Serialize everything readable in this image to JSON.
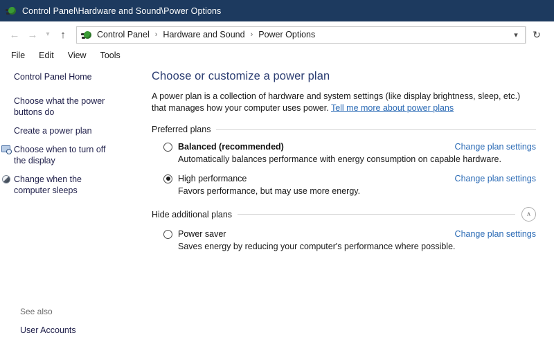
{
  "window": {
    "title": "Control Panel\\Hardware and Sound\\Power Options",
    "title_icon": "power-plug-icon"
  },
  "navbar": {
    "back_icon": "arrow-left-icon",
    "forward_icon": "arrow-right-icon",
    "recent_icon": "chevron-down-icon",
    "up_icon": "arrow-up-icon",
    "address_icon": "power-plug-icon",
    "breadcrumbs": [
      "Control Panel",
      "Hardware and Sound",
      "Power Options"
    ],
    "separator": "›",
    "dropdown_icon": "chevron-down-icon",
    "refresh_icon": "refresh-icon",
    "refresh_glyph": "↻"
  },
  "menubar": {
    "items": [
      "File",
      "Edit",
      "View",
      "Tools"
    ]
  },
  "sidebar": {
    "home": "Control Panel Home",
    "items": [
      {
        "label": "Choose what the power buttons do",
        "icon": ""
      },
      {
        "label": "Create a power plan",
        "icon": ""
      },
      {
        "label": "Choose when to turn off the display",
        "icon": "display-clock-icon"
      },
      {
        "label": "Change when the computer sleeps",
        "icon": "moon-sleep-icon"
      }
    ],
    "see_also_label": "See also",
    "see_also_links": [
      "User Accounts"
    ]
  },
  "main": {
    "title": "Choose or customize a power plan",
    "intro_text": "A power plan is a collection of hardware and system settings (like display brightness, sleep, etc.) that manages how your computer uses power. ",
    "intro_link": "Tell me more about power plans",
    "preferred_group_label": "Preferred plans",
    "additional_group_label": "Hide additional plans",
    "collapse_icon": "chevron-up-icon",
    "collapse_glyph": "∧",
    "change_link_label": "Change plan settings",
    "preferred_plans": [
      {
        "name": "Balanced (recommended)",
        "description": "Automatically balances performance with energy consumption on capable hardware.",
        "selected": false,
        "bold": true,
        "link": "Change plan settings"
      },
      {
        "name": "High performance",
        "description": "Favors performance, but may use more energy.",
        "selected": true,
        "bold": false,
        "link": "Change plan settings"
      }
    ],
    "additional_plans": [
      {
        "name": "Power saver",
        "description": "Saves energy by reducing your computer's performance where possible.",
        "selected": false,
        "bold": false,
        "link": "Change plan settings"
      }
    ]
  },
  "colors": {
    "titlebar_bg": "#1d3a5f",
    "heading": "#2b3d72",
    "link": "#2a6ab5",
    "sidebar_link": "#1f1f4a"
  }
}
